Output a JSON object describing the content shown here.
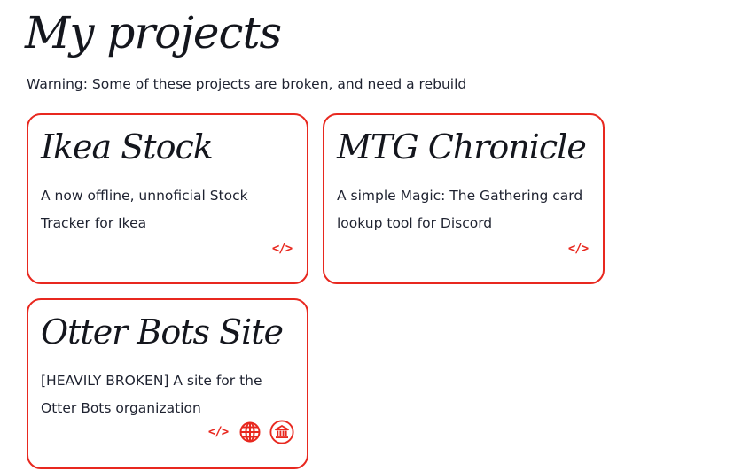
{
  "page": {
    "title": "My projects",
    "warning": "Warning: Some of these projects are broken, and need a rebuild"
  },
  "projects": [
    {
      "title": "Ikea Stock",
      "description": "A now offline, unnoficial Stock Tracker for Ikea",
      "links": [
        {
          "icon": "code-icon",
          "glyph": "</>"
        }
      ]
    },
    {
      "title": "MTG Chronicle",
      "description": "A simple Magic: The Gathering card lookup tool for Discord",
      "links": [
        {
          "icon": "code-icon",
          "glyph": "</>"
        }
      ]
    },
    {
      "title": "Otter Bots Site",
      "description": "[HEAVILY BROKEN] A site for the Otter Bots organization",
      "links": [
        {
          "icon": "code-icon",
          "glyph": "</>"
        },
        {
          "icon": "globe-icon"
        },
        {
          "icon": "bank-icon"
        }
      ]
    }
  ],
  "colors": {
    "accent": "#e8281f",
    "text": "#1e2230",
    "heading": "#14161d",
    "background": "#ffffff"
  }
}
